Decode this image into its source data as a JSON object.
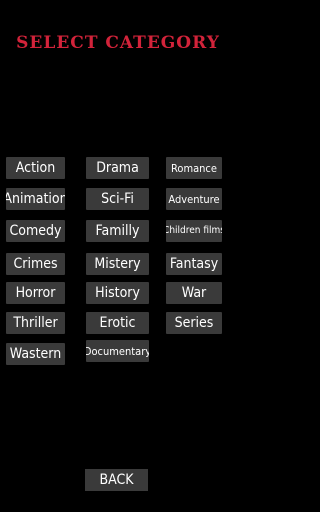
{
  "title": "Select Category",
  "colors": {
    "background": "#000000",
    "title": "#d2233a",
    "button_bg": "#3a3a3a",
    "button_text": "#ffffff"
  },
  "categories": [
    "Action",
    "Drama",
    "Romance",
    "Animation",
    "Sci-Fi",
    "Adventure",
    "Comedy",
    "Familly",
    "Children films",
    "Crimes",
    "Mistery",
    "Fantasy",
    "Horror",
    "History",
    "War",
    "Thriller",
    "Erotic",
    "Series",
    "Wastern",
    "Documentary"
  ],
  "back_label": "BACK"
}
